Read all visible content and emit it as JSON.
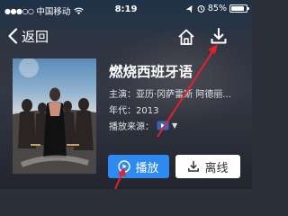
{
  "status_bar": {
    "signal_dots": "●●●○○",
    "carrier": "中国移动",
    "time": "8:19",
    "battery": "85%",
    "battery_level": 0.85
  },
  "nav": {
    "back_label": "返回",
    "home_icon": "home-icon",
    "download_icon": "download-icon"
  },
  "movie": {
    "title": "燃烧西班牙语",
    "cast": "主演：亚历·冈萨雷斯 阿德丽...",
    "year": "年代：2013",
    "source_label": "播放来源："
  },
  "actions": {
    "play_label": "播放",
    "offline_label": "离线"
  },
  "colors": {
    "play_button": "#2e8af0",
    "arrow": "#e6202a",
    "offline_button": "#ffffff"
  }
}
